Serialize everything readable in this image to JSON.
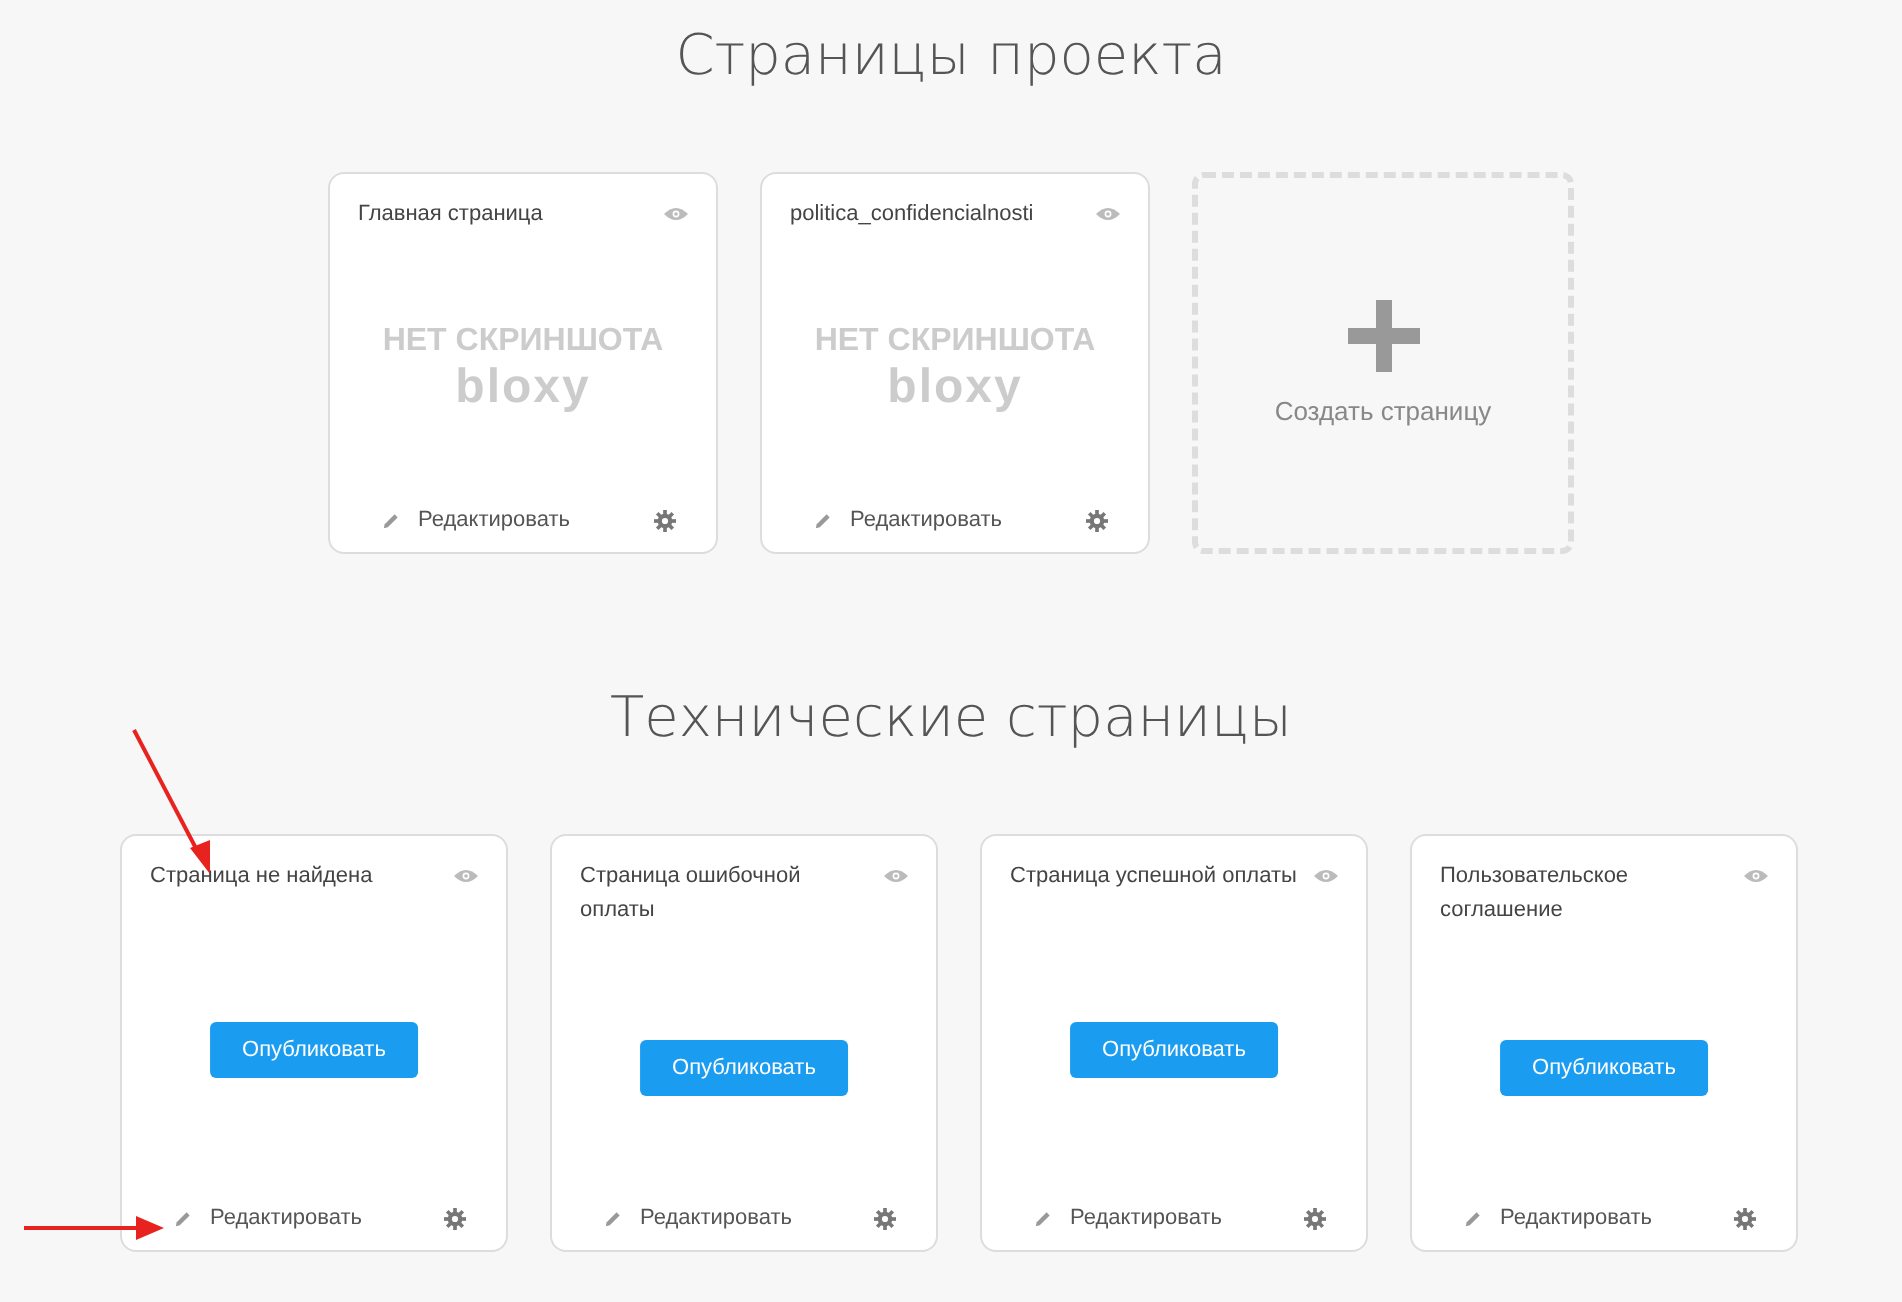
{
  "sections": [
    {
      "title": "Страницы проекта",
      "pages": [
        {
          "title": "Главная страница",
          "placeholder": "НЕТ СКРИНШОТА",
          "logo": "bloxy",
          "published": true,
          "edit": "Редактировать"
        },
        {
          "title": "politica_confidencialnosti",
          "placeholder": "НЕТ СКРИНШОТА",
          "logo": "bloxy",
          "published": true,
          "edit": "Редактировать"
        }
      ],
      "create": "Создать страницу"
    },
    {
      "title": "Технические страницы",
      "pages": [
        {
          "title": "Страница не найдена",
          "published": false,
          "publish": "Опубликовать",
          "edit": "Редактировать"
        },
        {
          "title": "Страница ошибочной оплаты",
          "published": false,
          "publish": "Опубликовать",
          "edit": "Редактировать"
        },
        {
          "title": "Страница успешной оплаты",
          "published": false,
          "publish": "Опубликовать",
          "edit": "Редактировать"
        },
        {
          "title": "Пользовательское соглашение",
          "published": false,
          "publish": "Опубликовать",
          "edit": "Редактировать"
        }
      ]
    }
  ],
  "annotations": [
    {
      "kind": "down-arrow"
    },
    {
      "kind": "right-arrow"
    }
  ]
}
